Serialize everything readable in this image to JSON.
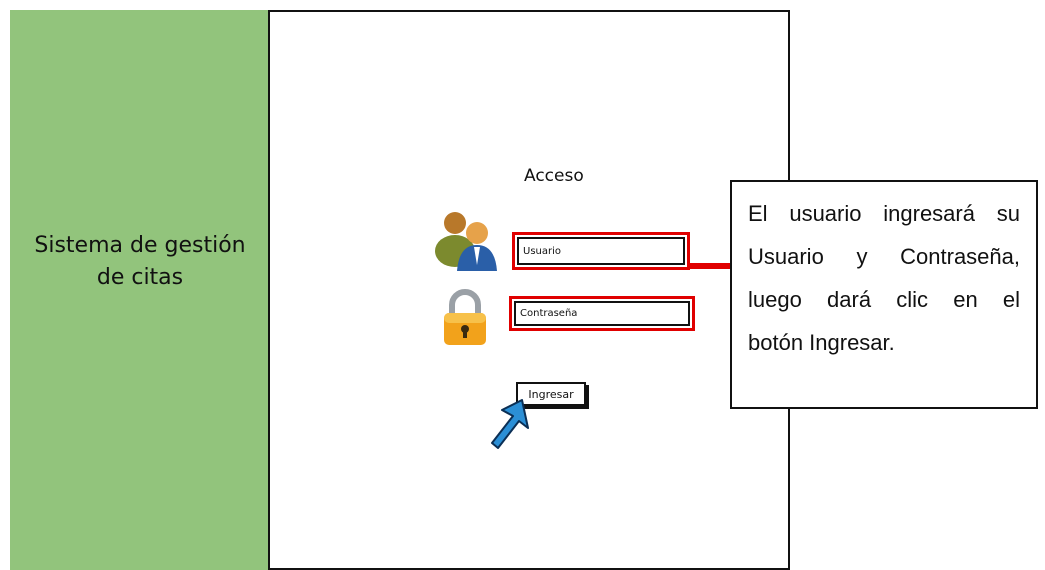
{
  "sidebar": {
    "title_line1": "Sistema de gestión",
    "title_line2": "de citas"
  },
  "login": {
    "title": "Acceso",
    "username_placeholder": "Usuario",
    "password_placeholder": "Contraseña",
    "submit_label": "Ingresar"
  },
  "annotation": {
    "lines": [
      "El usuario ingresará su",
      "Usuario y Contraseña,",
      "luego dará clic en el",
      "botón Ingresar."
    ]
  },
  "colors": {
    "sidebar": "#92c47c",
    "highlight": "#e00000",
    "cursor": "#2b8fd6"
  },
  "icons": {
    "users": "users-icon",
    "lock": "lock-icon",
    "cursor": "cursor-arrow-icon"
  }
}
